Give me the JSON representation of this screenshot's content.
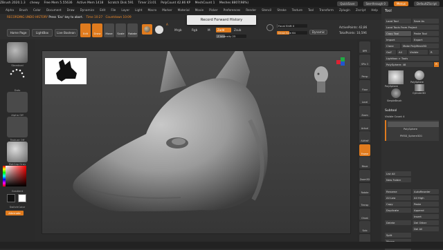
{
  "topbar": {
    "items": [
      "ZBrush 2020.1.3",
      "chewy",
      "Free Mem 5.55636",
      "Active Mem 1418",
      "Scratch Disk 591",
      "Timer 23.01",
      "PolyCount 42.86 KP",
      "MeshCount 1",
      "Meshes 8807(98%)"
    ],
    "quicksave": "QuickSave",
    "seethrough": "See-through 0",
    "menus": "Menus",
    "defaultscript": "DefaultZScript"
  },
  "menubar": {
    "items": [
      "Alpha",
      "Brush",
      "Color",
      "Document",
      "Draw",
      "Dynamics",
      "Edit",
      "File",
      "Layer",
      "Light",
      "Macro",
      "Marker",
      "Material",
      "Movie",
      "Picker",
      "Preferences",
      "Render",
      "Stencil",
      "Stroke",
      "Texture",
      "Tool",
      "Transform",
      "Zplugin",
      "Zscript",
      "Help"
    ]
  },
  "status": {
    "prefix": "RECORDING UNDO HISTORY",
    "message": " Press 'Esc' key to abort.",
    "timer": "Time 10:27",
    "countdown": "Countdown 10:09"
  },
  "tooltip": "Record Forward History",
  "toolbar": {
    "home": "Home Page",
    "lightbox": "LightBox",
    "live": "Live Boolean",
    "edit": "Edit",
    "draw": "Draw",
    "move": "Move",
    "scale": "Scale",
    "rotate": "Rotate",
    "mrgb": "Mrgb",
    "rgb": "Rgb",
    "m": "M",
    "zadd": "Zadd",
    "zsub": "Zsub",
    "zintensity": "Z Intensity 25",
    "rgb_intensity": "Rgb Intensity",
    "focal_shift": "Focal Shift 0",
    "draw_size": "Draw Size 64",
    "dynamic": "Dynamic",
    "active_points": "ActivePoints: 42,86",
    "total_points": "TotalPoints: 10,596"
  },
  "leftshelf": {
    "brush": "Standard",
    "stroke": "Dots",
    "alpha": "Alpha Off",
    "texture": "Texture Off",
    "material": "MatCap Gray",
    "gradient": "Gradient",
    "switch": "SwitchColor",
    "alternate": "Alternate"
  },
  "rightshelf": [
    "BPR",
    "SPix 3",
    "Persp",
    "Floor",
    "Local",
    "Zoom",
    "Actual",
    "AAHalf",
    "Frame",
    "Move",
    "Zoom3D",
    "Rotate",
    "Transp",
    "Ghost",
    "Solo",
    "Xpose"
  ],
  "panel": {
    "title": "Tool",
    "load": "Load Tool",
    "saveas": "Save As",
    "loadproject": "Load Tools From Project",
    "copy": "Copy Tool",
    "paste": "Paste Tool",
    "import": "Import",
    "export": "Export",
    "clone": "Clone",
    "makepoly": "Make PolyMesh3D",
    "goz": "GoZ",
    "all": "All",
    "visible": "Visible",
    "r": "R",
    "lightbox_tools": "Lightbox > Tools",
    "current_tool": "PolySphere: 48",
    "thumb_1": "PolySphere",
    "thumb_2": "PolySphere",
    "thumb_3": "Cylinder3D",
    "thumb_4": "SimpleBrush",
    "subtool": "Subtool",
    "visible_count": "Visible Count 4",
    "sub_1": "PolySphere",
    "sub_2": "PM3D_Sphere3D1",
    "list_all": "List All",
    "new_folder": "New Folder",
    "rename": "Rename",
    "autoreorder": "AutoReorder",
    "all_low": "All Low",
    "all_high": "All High",
    "copy_st": "Copy",
    "paste_st": "Paste",
    "duplicate": "Duplicate",
    "append": "Append",
    "insert": "Insert",
    "delete": "Delete",
    "del_other": "Del Other",
    "del_all": "Del All",
    "split": "Split",
    "merge": "Merge",
    "boolean": "Boolean"
  },
  "colors": {
    "accent": "#e07b1e",
    "bg": "#2b2b2b",
    "model": "#9a9a9a"
  }
}
